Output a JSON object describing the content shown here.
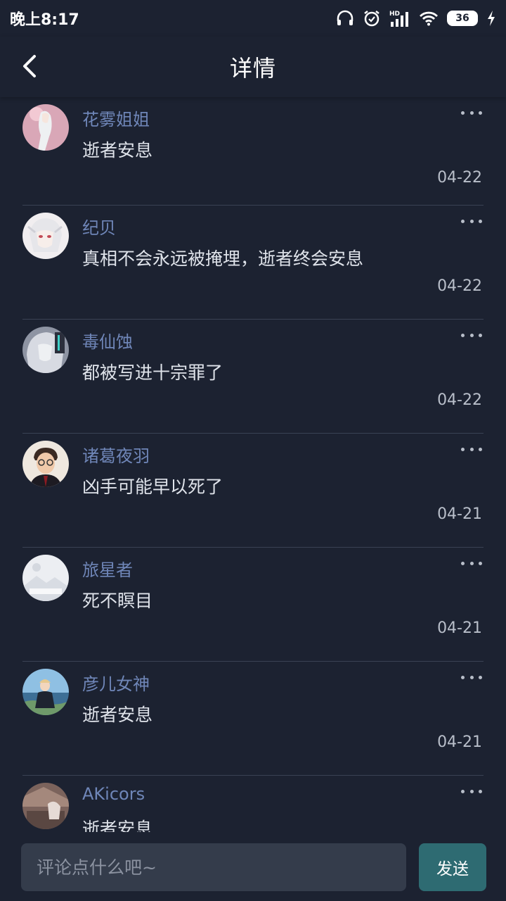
{
  "status_bar": {
    "time": "晚上8:17",
    "battery": "36",
    "icons": [
      "headset-icon",
      "alarm-icon",
      "hd-signal-icon",
      "wifi-icon",
      "battery-icon",
      "charging-icon"
    ]
  },
  "header": {
    "title": "详情",
    "back_icon": "chevron-left-icon"
  },
  "comments": [
    {
      "username": "花雾姐姐",
      "text": "逝者安息",
      "date": "04-22",
      "avatar_color": "#d9a7b7"
    },
    {
      "username": "纪贝",
      "text": "真相不会永远被掩埋，逝者终会安息",
      "date": "04-22",
      "avatar_color": "#e9e4e6"
    },
    {
      "username": "毒仙蚀",
      "text": "都被写进十宗罪了",
      "date": "04-22",
      "avatar_color": "#9aa0b0"
    },
    {
      "username": "诸葛夜羽",
      "text": "凶手可能早以死了",
      "date": "04-21",
      "avatar_color": "#e8ddd2"
    },
    {
      "username": "旅星者",
      "text": "死不瞑目",
      "date": "04-21",
      "avatar_color": "#e5e8ed"
    },
    {
      "username": "彦儿女神",
      "text": "逝者安息",
      "date": "04-21",
      "avatar_color": "#7fb0d6"
    },
    {
      "username": "AKicors",
      "text": "逝者安息",
      "date": "",
      "avatar_color": "#8a6f66"
    }
  ],
  "bottom_bar": {
    "input_placeholder": "评论点什么吧~",
    "send_label": "发送"
  },
  "colors": {
    "background": "#1c2231",
    "username": "#6f86b8",
    "send_button": "#2e6b72",
    "input_background": "#343c4b"
  }
}
